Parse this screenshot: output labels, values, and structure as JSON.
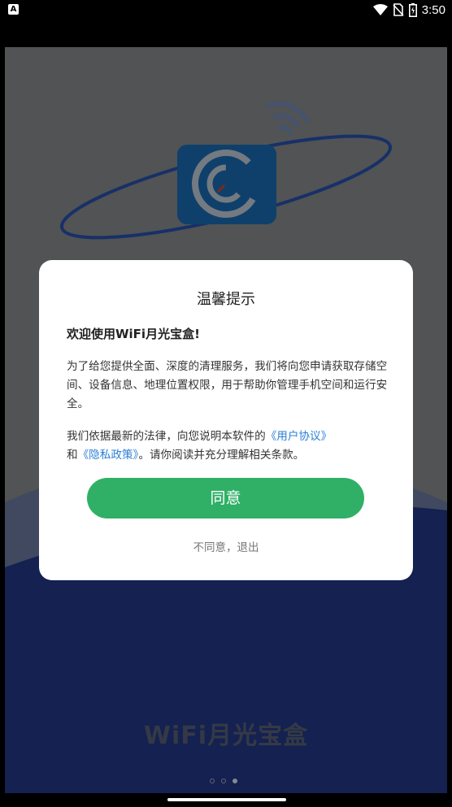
{
  "status_bar": {
    "left_icon_label": "A",
    "time": "3:50",
    "icons": [
      "wifi-icon",
      "no-sim-icon",
      "battery-icon"
    ]
  },
  "splash": {
    "brand_text": "WiFi月光宝盒",
    "page_indicator": {
      "count": 3,
      "active_index": 2
    },
    "colors": {
      "background": "#8c8f91",
      "wave": "#24398c",
      "logo": "#1b6fb8"
    }
  },
  "dialog": {
    "title": "温馨提示",
    "welcome": "欢迎使用WiFi月光宝盒!",
    "paragraph1": "为了给您提供全面、深度的清理服务，我们将向您申请获取存储空间、设备信息、地理位置权限，用于帮助你管理手机空间和运行安全。",
    "paragraph2_prefix": "我们依据最新的法律，向您说明本软件的",
    "user_agreement_link": "《用户协议》",
    "paragraph2_and": "和",
    "privacy_policy_link": "《隐私政策》",
    "paragraph2_suffix": "。请你阅读并充分理解相关条款。",
    "agree_button": "同意",
    "disagree_link": "不同意，退出",
    "colors": {
      "button": "#2fb066",
      "link": "#2b7fd6"
    }
  }
}
